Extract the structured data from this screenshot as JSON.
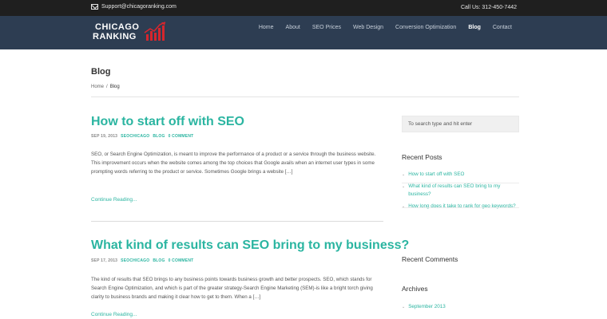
{
  "topbar": {
    "email": "Support@chicagoranking.com",
    "phone": "Call Us: 312-450-7442"
  },
  "logo": {
    "line1": "CHICAGO",
    "line2": "RANKING"
  },
  "nav": [
    {
      "label": "Home"
    },
    {
      "label": "About"
    },
    {
      "label": "SEO Prices"
    },
    {
      "label": "Web Design"
    },
    {
      "label": "Conversion Optimization"
    },
    {
      "label": "Blog"
    },
    {
      "label": "Contact"
    }
  ],
  "page": {
    "title": "Blog",
    "breadcrumb_home": "Home",
    "breadcrumb_sep": "/",
    "breadcrumb_current": "Blog"
  },
  "posts": [
    {
      "title": "How to start off with SEO",
      "date": "SEP 19, 2013",
      "author": "SEOCHICAGO",
      "category": "BLOG",
      "comments": "0 COMMENT",
      "excerpt": "SEO, or Search Engine Optimization, is meant to improve the performance of a product or a service through the business website. This improvement occurs when the website comes among the top choices that Google avails when an internet user types in some prompting words referring to the product or service. Sometimes Google brings a website […]",
      "more": "Continue Reading..."
    },
    {
      "title": "What kind of results can SEO bring to my business?",
      "date": "SEP 17, 2013",
      "author": "SEOCHICAGO",
      "category": "BLOG",
      "comments": "0 COMMENT",
      "excerpt": "The kind of results that SEO brings to any business points towards business growth and better prospects. SEO, which stands for Search Engine Optimization, and which is part of the greater strategy-Search Engine Marketing (SEM)-is like a bright torch giving clarity to business brands and making it clear how to get to them. When a […]",
      "more": "Continue Reading..."
    }
  ],
  "sidebar": {
    "search_placeholder": "To search type and hit enter",
    "recent_posts_title": "Recent Posts",
    "recent_posts": [
      "How to start off with SEO",
      "What kind of results can SEO bring to my business?",
      "How long does it take to rank for geo keywords?"
    ],
    "recent_comments_title": "Recent Comments",
    "archives_title": "Archives",
    "archives": [
      "September 2013"
    ]
  },
  "colors": {
    "accent": "#2bb5a1",
    "header_bg": "#2d3d52",
    "topbar_bg": "#1f1f1f",
    "logo_chart": "#d6262d"
  }
}
